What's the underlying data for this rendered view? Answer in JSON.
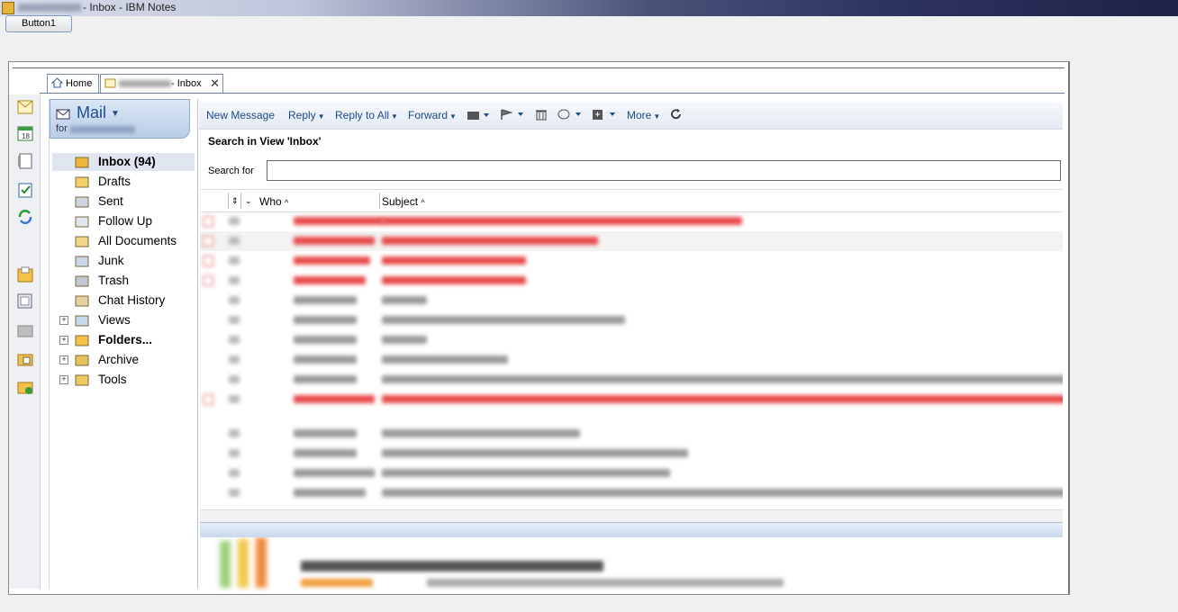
{
  "window": {
    "title_suffix": "- Inbox - IBM Notes"
  },
  "top_button": {
    "label": "Button1"
  },
  "tabs": [
    {
      "label": "Home"
    },
    {
      "label": "- Inbox"
    }
  ],
  "nav": {
    "header_title": "Mail",
    "header_for": "for",
    "items": [
      {
        "label": "Inbox (94)",
        "icon": "inbox-icon"
      },
      {
        "label": "Drafts",
        "icon": "drafts-icon"
      },
      {
        "label": "Sent",
        "icon": "sent-icon"
      },
      {
        "label": "Follow Up",
        "icon": "flag-icon"
      },
      {
        "label": "All Documents",
        "icon": "all-documents-icon"
      },
      {
        "label": "Junk",
        "icon": "junk-icon"
      },
      {
        "label": "Trash",
        "icon": "trash-icon"
      },
      {
        "label": "Chat History",
        "icon": "chat-icon"
      },
      {
        "label": "Views",
        "icon": "views-icon"
      },
      {
        "label": "Folders...",
        "icon": "folder-icon"
      },
      {
        "label": "Archive",
        "icon": "archive-icon"
      },
      {
        "label": "Tools",
        "icon": "tools-icon"
      }
    ]
  },
  "toolbar": {
    "new_message": "New Message",
    "reply": "Reply",
    "reply_all": "Reply to All",
    "forward": "Forward",
    "more": "More"
  },
  "search": {
    "heading": "Search in View 'Inbox'",
    "label": "Search for",
    "value": ""
  },
  "columns": {
    "who": "Who",
    "subject": "Subject"
  },
  "colors": {
    "unread": "#e84a4a",
    "read": "#9a9a9a",
    "accent": "#1c4a8c"
  }
}
